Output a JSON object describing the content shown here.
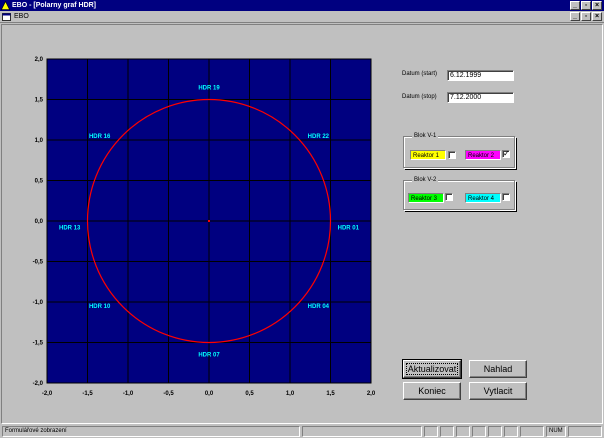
{
  "window": {
    "title": "EBO - [Polarny graf HDR]",
    "menu": "EBO",
    "minimize_glyph": "_",
    "restore_glyph": "▫",
    "close_glyph": "×"
  },
  "chart_data": {
    "type": "scatter",
    "title": "",
    "xlim": [
      -2.0,
      2.0
    ],
    "ylim": [
      -2.0,
      2.0
    ],
    "x_ticks": [
      "-2,0",
      "-1,5",
      "-1,0",
      "-0,5",
      "0,0",
      "0,5",
      "1,0",
      "1,5",
      "2,0"
    ],
    "y_ticks": [
      "2,0",
      "1,5",
      "1,0",
      "0,5",
      "0,0",
      "-0,5",
      "-1,0",
      "-1,5",
      "-2,0"
    ],
    "grid": true,
    "background_color": "#000080",
    "grid_color": "#000000",
    "series": [
      {
        "name": "",
        "shape": "circle",
        "center": [
          0,
          0
        ],
        "radius": 1.5,
        "color": "#ff0000"
      }
    ],
    "center_marker": {
      "x": 0,
      "y": 0,
      "color": "#ff0000"
    },
    "annotations": [
      {
        "label": "HDR 19",
        "x": 0.0,
        "y": 1.65
      },
      {
        "label": "HDR 22",
        "x": 1.35,
        "y": 1.05
      },
      {
        "label": "HDR 01",
        "x": 1.72,
        "y": -0.08
      },
      {
        "label": "HDR 04",
        "x": 1.35,
        "y": -1.05
      },
      {
        "label": "HDR 07",
        "x": 0.0,
        "y": -1.65
      },
      {
        "label": "HDR 10",
        "x": -1.35,
        "y": -1.05
      },
      {
        "label": "HDR 13",
        "x": -1.72,
        "y": -0.08
      },
      {
        "label": "HDR 16",
        "x": -1.35,
        "y": 1.05
      }
    ]
  },
  "form": {
    "start_label": "Datum (start)",
    "start_value": "6.12.1999",
    "stop_label": "Datum (stop)",
    "stop_value": "7.12.2000",
    "blok1": {
      "title": "Blok V-1",
      "reaktor1": {
        "label": "Reaktor 1",
        "color": "#ffff00",
        "checked": false
      },
      "reaktor2": {
        "label": "Reaktor 2",
        "color": "#ff00ff",
        "checked": true
      }
    },
    "blok2": {
      "title": "Blok V-2",
      "reaktor3": {
        "label": "Reaktor 3",
        "color": "#00ff00",
        "checked": false
      },
      "reaktor4": {
        "label": "Reaktor 4",
        "color": "#00ffff",
        "checked": false
      }
    },
    "checkmark": "✓"
  },
  "buttons": {
    "aktualizovat": "Aktualizovat",
    "nahlad": "Nahlad",
    "koniec": "Koniec",
    "vytlacit": "Vytlacit"
  },
  "status": {
    "text": "Formulářové zobrazení",
    "num": "NUM"
  }
}
